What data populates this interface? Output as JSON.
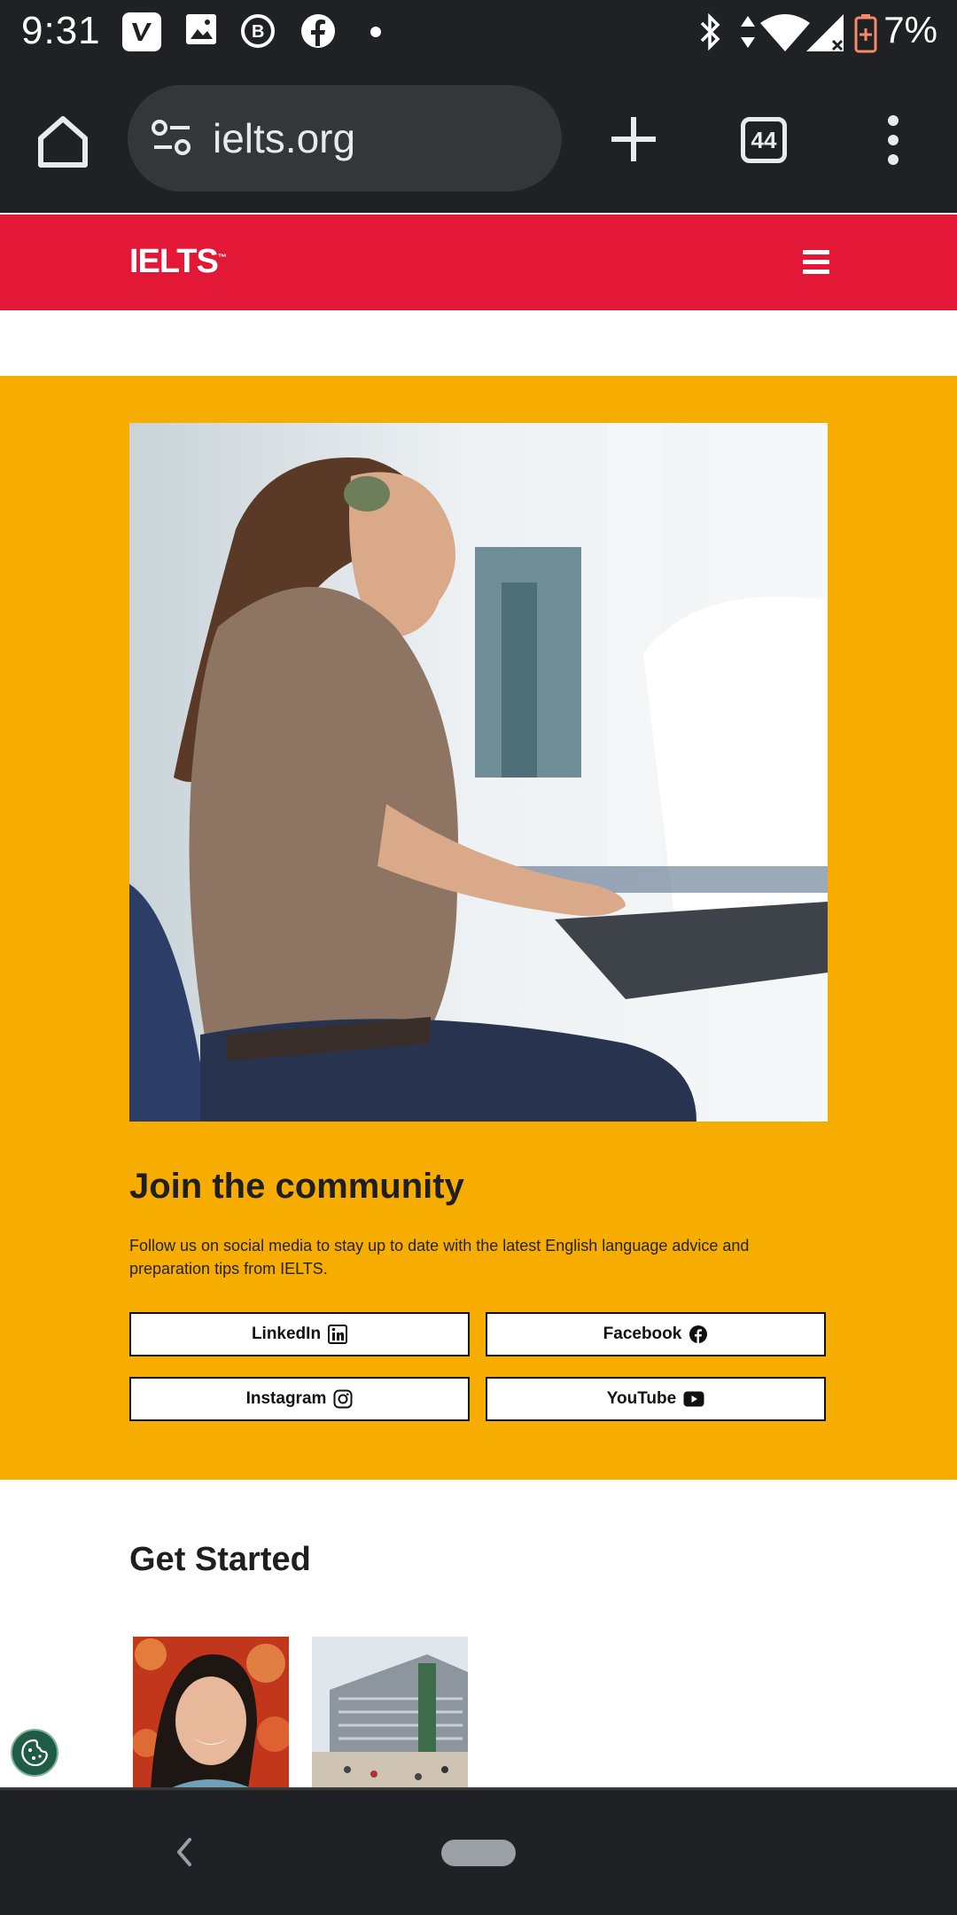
{
  "status_bar": {
    "time": "9:31",
    "battery": "7%"
  },
  "browser": {
    "url": "ielts.org",
    "tab_count": "44"
  },
  "site": {
    "logo": "IELTS",
    "logo_mark": "™"
  },
  "community": {
    "title": "Join the community",
    "description": "Follow us on social media to stay up to date with the latest English language advice and preparation tips from IELTS.",
    "buttons": [
      {
        "label": "LinkedIn",
        "icon": "linkedin-icon"
      },
      {
        "label": "Facebook",
        "icon": "facebook-icon"
      },
      {
        "label": "Instagram",
        "icon": "instagram-icon"
      },
      {
        "label": "YouTube",
        "icon": "youtube-icon"
      }
    ]
  },
  "get_started": {
    "title": "Get Started"
  },
  "colors": {
    "brand_red": "#e31837",
    "section_yellow": "#f7ad00",
    "chrome_dark": "#202124"
  }
}
